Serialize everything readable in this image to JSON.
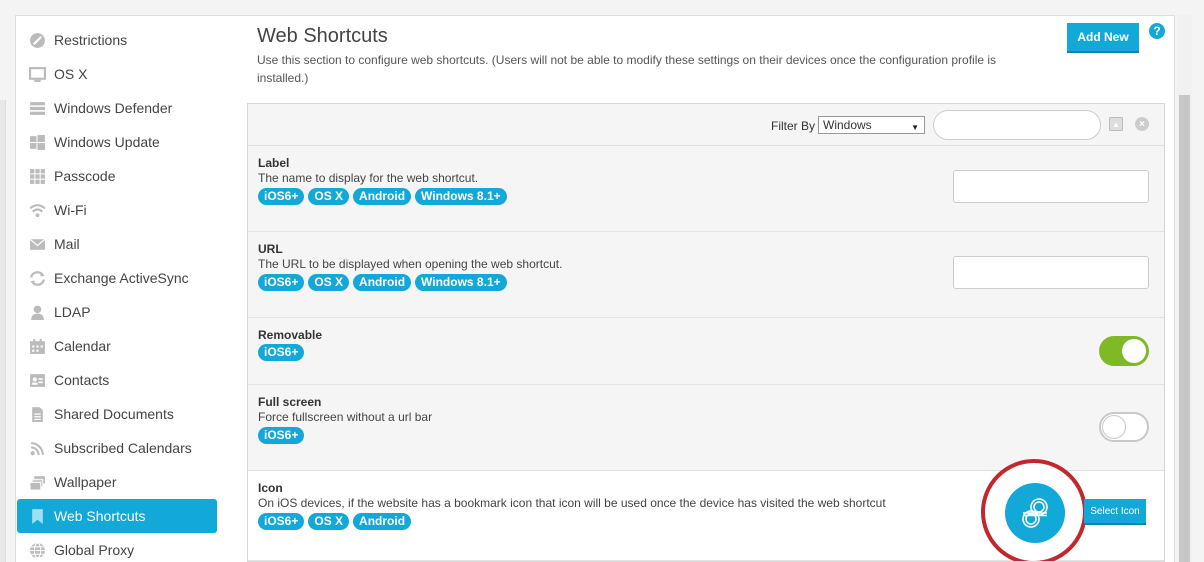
{
  "sidebar": {
    "items": [
      {
        "label": "Restrictions",
        "icon": "restrictions-icon"
      },
      {
        "label": "OS X",
        "icon": "monitor-icon"
      },
      {
        "label": "Windows Defender",
        "icon": "wall-icon"
      },
      {
        "label": "Windows Update",
        "icon": "windows-icon"
      },
      {
        "label": "Passcode",
        "icon": "keypad-icon"
      },
      {
        "label": "Wi-Fi",
        "icon": "wifi-icon"
      },
      {
        "label": "Mail",
        "icon": "mail-icon"
      },
      {
        "label": "Exchange ActiveSync",
        "icon": "sync-icon"
      },
      {
        "label": "LDAP",
        "icon": "user-icon"
      },
      {
        "label": "Calendar",
        "icon": "calendar-icon"
      },
      {
        "label": "Contacts",
        "icon": "contacts-icon"
      },
      {
        "label": "Shared Documents",
        "icon": "document-icon"
      },
      {
        "label": "Subscribed Calendars",
        "icon": "rss-icon"
      },
      {
        "label": "Wallpaper",
        "icon": "wallpaper-icon"
      },
      {
        "label": "Web Shortcuts",
        "icon": "bookmark-icon",
        "active": true
      },
      {
        "label": "Global Proxy",
        "icon": "globe-icon"
      }
    ]
  },
  "header": {
    "title": "Web Shortcuts",
    "description": "Use this section to configure web shortcuts. (Users will not be able to modify these settings on their devices once the configuration profile is installed.)",
    "add_button": "Add New",
    "help": "?"
  },
  "filter": {
    "label": "Filter By",
    "selected": "Windows",
    "search_value": ""
  },
  "rows": {
    "label": {
      "title": "Label",
      "desc": "The name to display for the web shortcut.",
      "tags": [
        "iOS6+",
        "OS X",
        "Android",
        "Windows 8.1+"
      ],
      "value": ""
    },
    "url": {
      "title": "URL",
      "desc": "The URL to be displayed when opening the web shortcut.",
      "tags": [
        "iOS6+",
        "OS X",
        "Android",
        "Windows 8.1+"
      ],
      "value": ""
    },
    "removable": {
      "title": "Removable",
      "tags": [
        "iOS6+"
      ],
      "on": true
    },
    "fullscreen": {
      "title": "Full screen",
      "desc": "Force fullscreen without a url bar",
      "tags": [
        "iOS6+"
      ],
      "on": false
    },
    "icon": {
      "title": "Icon",
      "desc": "On iOS devices, if the website has a bookmark icon that icon will be used once the device has visited the web shortcut",
      "tags": [
        "iOS6+",
        "OS X",
        "Android"
      ],
      "button": "Select Icon"
    }
  },
  "colors": {
    "accent": "#12a8d8",
    "toggle_on": "#7fba26",
    "highlight_circle": "#c1272d"
  }
}
